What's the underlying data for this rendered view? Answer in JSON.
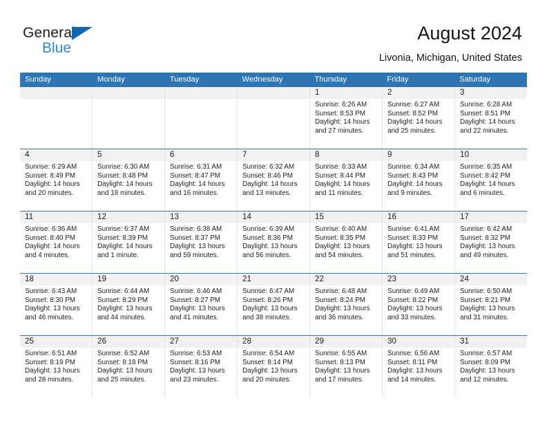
{
  "brand": {
    "name_primary": "General",
    "name_secondary": "Blue",
    "triangle_icon": "triangle-icon",
    "accent_color": "#2f87d4",
    "logo_triangle_color": "#1066b0"
  },
  "header": {
    "title": "August 2024",
    "subtitle": "Livonia, Michigan, United States"
  },
  "calendar": {
    "header_bg": "#2e75b6",
    "weekdays": [
      "Sunday",
      "Monday",
      "Tuesday",
      "Wednesday",
      "Thursday",
      "Friday",
      "Saturday"
    ],
    "labels": {
      "sunrise": "Sunrise:",
      "sunset": "Sunset:",
      "daylight": "Daylight:"
    },
    "weeks": [
      [
        {
          "day": ""
        },
        {
          "day": ""
        },
        {
          "day": ""
        },
        {
          "day": ""
        },
        {
          "day": "1",
          "sunrise": "Sunrise: 6:26 AM",
          "sunset": "Sunset: 8:53 PM",
          "daylight_1": "Daylight: 14 hours",
          "daylight_2": "and 27 minutes."
        },
        {
          "day": "2",
          "sunrise": "Sunrise: 6:27 AM",
          "sunset": "Sunset: 8:52 PM",
          "daylight_1": "Daylight: 14 hours",
          "daylight_2": "and 25 minutes."
        },
        {
          "day": "3",
          "sunrise": "Sunrise: 6:28 AM",
          "sunset": "Sunset: 8:51 PM",
          "daylight_1": "Daylight: 14 hours",
          "daylight_2": "and 22 minutes."
        }
      ],
      [
        {
          "day": "4",
          "sunrise": "Sunrise: 6:29 AM",
          "sunset": "Sunset: 8:49 PM",
          "daylight_1": "Daylight: 14 hours",
          "daylight_2": "and 20 minutes."
        },
        {
          "day": "5",
          "sunrise": "Sunrise: 6:30 AM",
          "sunset": "Sunset: 8:48 PM",
          "daylight_1": "Daylight: 14 hours",
          "daylight_2": "and 18 minutes."
        },
        {
          "day": "6",
          "sunrise": "Sunrise: 6:31 AM",
          "sunset": "Sunset: 8:47 PM",
          "daylight_1": "Daylight: 14 hours",
          "daylight_2": "and 16 minutes."
        },
        {
          "day": "7",
          "sunrise": "Sunrise: 6:32 AM",
          "sunset": "Sunset: 8:46 PM",
          "daylight_1": "Daylight: 14 hours",
          "daylight_2": "and 13 minutes."
        },
        {
          "day": "8",
          "sunrise": "Sunrise: 6:33 AM",
          "sunset": "Sunset: 8:44 PM",
          "daylight_1": "Daylight: 14 hours",
          "daylight_2": "and 11 minutes."
        },
        {
          "day": "9",
          "sunrise": "Sunrise: 6:34 AM",
          "sunset": "Sunset: 8:43 PM",
          "daylight_1": "Daylight: 14 hours",
          "daylight_2": "and 9 minutes."
        },
        {
          "day": "10",
          "sunrise": "Sunrise: 6:35 AM",
          "sunset": "Sunset: 8:42 PM",
          "daylight_1": "Daylight: 14 hours",
          "daylight_2": "and 6 minutes."
        }
      ],
      [
        {
          "day": "11",
          "sunrise": "Sunrise: 6:36 AM",
          "sunset": "Sunset: 8:40 PM",
          "daylight_1": "Daylight: 14 hours",
          "daylight_2": "and 4 minutes."
        },
        {
          "day": "12",
          "sunrise": "Sunrise: 6:37 AM",
          "sunset": "Sunset: 8:39 PM",
          "daylight_1": "Daylight: 14 hours",
          "daylight_2": "and 1 minute."
        },
        {
          "day": "13",
          "sunrise": "Sunrise: 6:38 AM",
          "sunset": "Sunset: 8:37 PM",
          "daylight_1": "Daylight: 13 hours",
          "daylight_2": "and 59 minutes."
        },
        {
          "day": "14",
          "sunrise": "Sunrise: 6:39 AM",
          "sunset": "Sunset: 8:36 PM",
          "daylight_1": "Daylight: 13 hours",
          "daylight_2": "and 56 minutes."
        },
        {
          "day": "15",
          "sunrise": "Sunrise: 6:40 AM",
          "sunset": "Sunset: 8:35 PM",
          "daylight_1": "Daylight: 13 hours",
          "daylight_2": "and 54 minutes."
        },
        {
          "day": "16",
          "sunrise": "Sunrise: 6:41 AM",
          "sunset": "Sunset: 8:33 PM",
          "daylight_1": "Daylight: 13 hours",
          "daylight_2": "and 51 minutes."
        },
        {
          "day": "17",
          "sunrise": "Sunrise: 6:42 AM",
          "sunset": "Sunset: 8:32 PM",
          "daylight_1": "Daylight: 13 hours",
          "daylight_2": "and 49 minutes."
        }
      ],
      [
        {
          "day": "18",
          "sunrise": "Sunrise: 6:43 AM",
          "sunset": "Sunset: 8:30 PM",
          "daylight_1": "Daylight: 13 hours",
          "daylight_2": "and 46 minutes."
        },
        {
          "day": "19",
          "sunrise": "Sunrise: 6:44 AM",
          "sunset": "Sunset: 8:29 PM",
          "daylight_1": "Daylight: 13 hours",
          "daylight_2": "and 44 minutes."
        },
        {
          "day": "20",
          "sunrise": "Sunrise: 6:46 AM",
          "sunset": "Sunset: 8:27 PM",
          "daylight_1": "Daylight: 13 hours",
          "daylight_2": "and 41 minutes."
        },
        {
          "day": "21",
          "sunrise": "Sunrise: 6:47 AM",
          "sunset": "Sunset: 8:26 PM",
          "daylight_1": "Daylight: 13 hours",
          "daylight_2": "and 38 minutes."
        },
        {
          "day": "22",
          "sunrise": "Sunrise: 6:48 AM",
          "sunset": "Sunset: 8:24 PM",
          "daylight_1": "Daylight: 13 hours",
          "daylight_2": "and 36 minutes."
        },
        {
          "day": "23",
          "sunrise": "Sunrise: 6:49 AM",
          "sunset": "Sunset: 8:22 PM",
          "daylight_1": "Daylight: 13 hours",
          "daylight_2": "and 33 minutes."
        },
        {
          "day": "24",
          "sunrise": "Sunrise: 6:50 AM",
          "sunset": "Sunset: 8:21 PM",
          "daylight_1": "Daylight: 13 hours",
          "daylight_2": "and 31 minutes."
        }
      ],
      [
        {
          "day": "25",
          "sunrise": "Sunrise: 6:51 AM",
          "sunset": "Sunset: 8:19 PM",
          "daylight_1": "Daylight: 13 hours",
          "daylight_2": "and 28 minutes."
        },
        {
          "day": "26",
          "sunrise": "Sunrise: 6:52 AM",
          "sunset": "Sunset: 8:18 PM",
          "daylight_1": "Daylight: 13 hours",
          "daylight_2": "and 25 minutes."
        },
        {
          "day": "27",
          "sunrise": "Sunrise: 6:53 AM",
          "sunset": "Sunset: 8:16 PM",
          "daylight_1": "Daylight: 13 hours",
          "daylight_2": "and 23 minutes."
        },
        {
          "day": "28",
          "sunrise": "Sunrise: 6:54 AM",
          "sunset": "Sunset: 8:14 PM",
          "daylight_1": "Daylight: 13 hours",
          "daylight_2": "and 20 minutes."
        },
        {
          "day": "29",
          "sunrise": "Sunrise: 6:55 AM",
          "sunset": "Sunset: 8:13 PM",
          "daylight_1": "Daylight: 13 hours",
          "daylight_2": "and 17 minutes."
        },
        {
          "day": "30",
          "sunrise": "Sunrise: 6:56 AM",
          "sunset": "Sunset: 8:11 PM",
          "daylight_1": "Daylight: 13 hours",
          "daylight_2": "and 14 minutes."
        },
        {
          "day": "31",
          "sunrise": "Sunrise: 6:57 AM",
          "sunset": "Sunset: 8:09 PM",
          "daylight_1": "Daylight: 13 hours",
          "daylight_2": "and 12 minutes."
        }
      ]
    ]
  }
}
